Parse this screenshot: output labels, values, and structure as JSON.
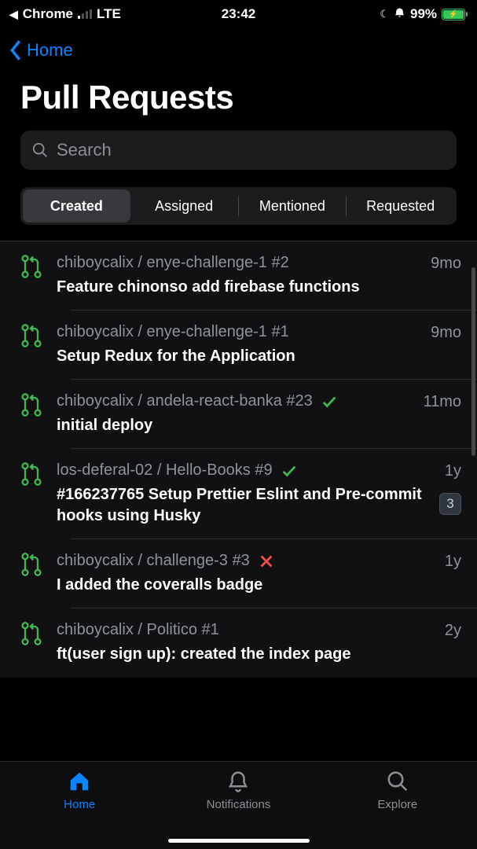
{
  "statusBar": {
    "backApp": "Chrome",
    "carrier": "LTE",
    "time": "23:42",
    "batteryPercent": "99%"
  },
  "nav": {
    "backLabel": "Home"
  },
  "title": "Pull Requests",
  "search": {
    "placeholder": "Search",
    "value": ""
  },
  "tabs": {
    "items": [
      {
        "label": "Created",
        "active": true
      },
      {
        "label": "Assigned",
        "active": false
      },
      {
        "label": "Mentioned",
        "active": false
      },
      {
        "label": "Requested",
        "active": false
      }
    ]
  },
  "pullRequests": [
    {
      "repo": "chiboycalix / enye-challenge-1 #2",
      "title": "Feature chinonso add firebase functions",
      "time": "9mo",
      "status": null,
      "badge": null
    },
    {
      "repo": "chiboycalix / enye-challenge-1 #1",
      "title": "Setup Redux for the Application",
      "time": "9mo",
      "status": null,
      "badge": null
    },
    {
      "repo": "chiboycalix / andela-react-banka #23",
      "title": "initial deploy",
      "time": "11mo",
      "status": "check",
      "badge": null
    },
    {
      "repo": "los-deferal-02 / Hello-Books #9",
      "title": "#166237765 Setup Prettier Eslint and Pre-commit hooks using Husky",
      "time": "1y",
      "status": "check",
      "badge": "3"
    },
    {
      "repo": "chiboycalix / challenge-3 #3",
      "title": "I added the coveralls badge",
      "time": "1y",
      "status": "x",
      "badge": null
    },
    {
      "repo": "chiboycalix / Politico #1",
      "title": "ft(user sign up): created the index page",
      "time": "2y",
      "status": null,
      "badge": null
    }
  ],
  "tabBar": {
    "items": [
      {
        "label": "Home",
        "icon": "home",
        "active": true
      },
      {
        "label": "Notifications",
        "icon": "bell",
        "active": false
      },
      {
        "label": "Explore",
        "icon": "search",
        "active": false
      }
    ]
  }
}
